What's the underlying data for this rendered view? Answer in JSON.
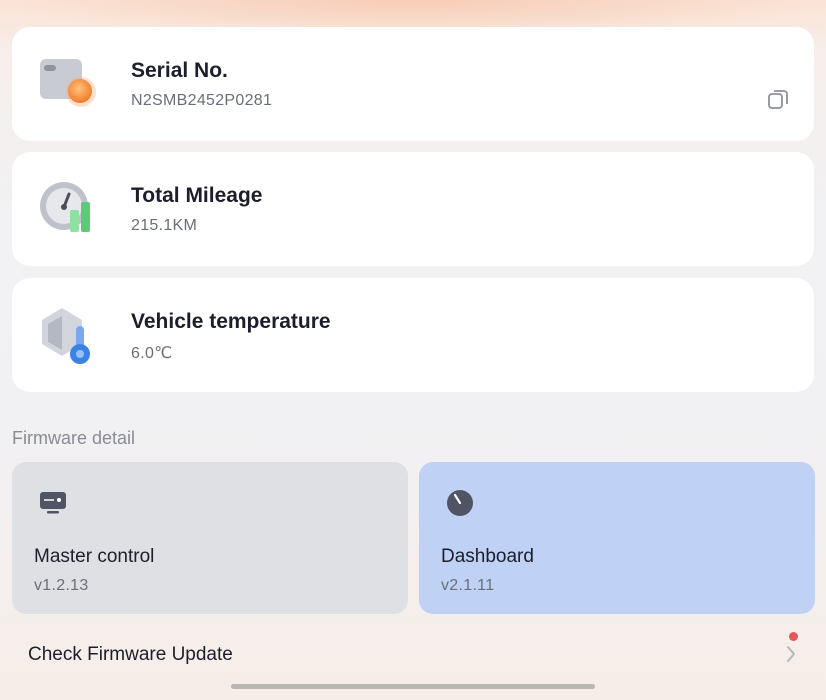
{
  "info_cards": [
    {
      "title": "Serial No.",
      "value": "N2SMB2452P0281",
      "icon": "serial-card-icon",
      "has_copy": true
    },
    {
      "title": "Total Mileage",
      "value": "215.1KM",
      "icon": "mileage-gauge-icon"
    },
    {
      "title": "Vehicle temperature",
      "value": "6.0℃",
      "icon": "temperature-icon"
    }
  ],
  "copy_icon": "copy-icon",
  "firmware": {
    "section_title": "Firmware detail",
    "items": [
      {
        "name": "Master control",
        "version": "v1.2.13",
        "icon": "controller-icon",
        "color": "#dfe0e3"
      },
      {
        "name": "Dashboard",
        "version": "v2.1.11",
        "icon": "dashboard-dial-icon",
        "color": "#bfd1f5"
      }
    ]
  },
  "update": {
    "label": "Check Firmware Update",
    "has_new": true,
    "dot_color": "#e2565c"
  }
}
